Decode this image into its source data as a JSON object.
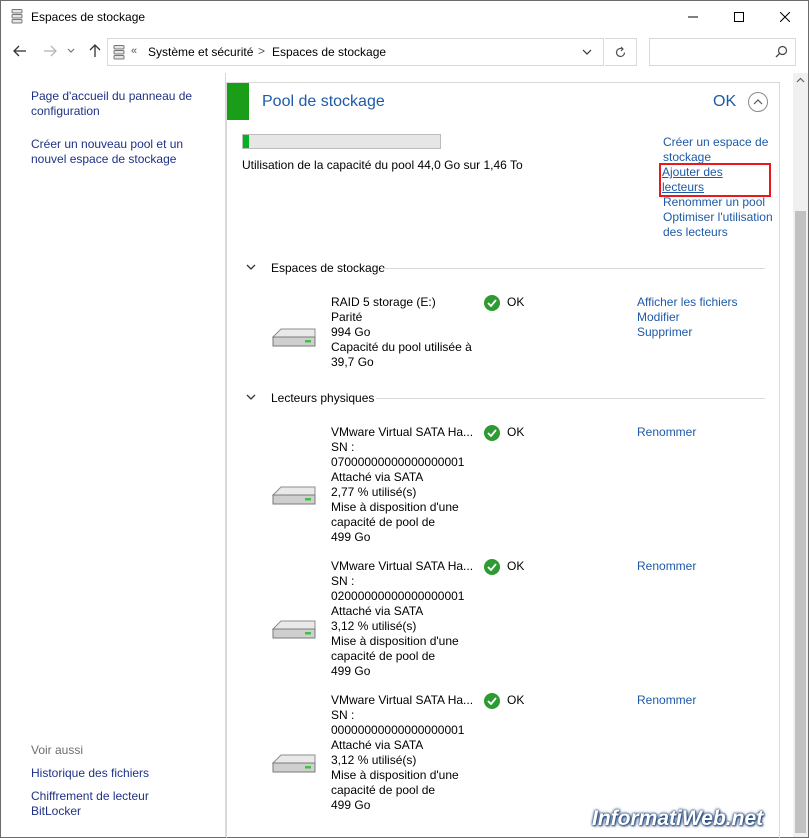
{
  "window": {
    "title": "Espaces de stockage"
  },
  "address_bar": {
    "overflow": "«",
    "crumb_1": "Système et sécurité",
    "separator": ">",
    "crumb_2": "Espaces de stockage",
    "search_placeholder": ""
  },
  "left_nav": {
    "links": [
      "Page d'accueil du panneau de configuration",
      "Créer un nouveau pool et un nouvel espace de stockage"
    ],
    "see_also_heading": "Voir aussi",
    "see_also_links": [
      "Historique des fichiers",
      "Chiffrement de lecteur BitLocker"
    ]
  },
  "pool": {
    "title": "Pool de stockage",
    "status": "OK",
    "usage_percent": 3,
    "usage_text": "Utilisation de la capacité du pool 44,0 Go sur 1,46 To",
    "actions": [
      "Créer un espace de stockage",
      "Ajouter des lecteurs",
      "Renommer un pool",
      "Optimiser l'utilisation des lecteurs"
    ]
  },
  "spaces_section": {
    "heading": "Espaces de stockage",
    "items": [
      {
        "lines": [
          "RAID 5 storage (E:)",
          "Parité",
          "994 Go",
          "Capacité du pool utilisée à 39,7 Go"
        ],
        "status": "OK",
        "actions": [
          "Afficher les fichiers",
          "Modifier",
          "Supprimer"
        ]
      }
    ]
  },
  "physical_section": {
    "heading": "Lecteurs physiques",
    "items": [
      {
        "lines": [
          "VMware Virtual SATA Ha...",
          "SN :",
          "07000000000000000001",
          "Attaché via SATA",
          "2,77 % utilisé(s)",
          "Mise à disposition d'une capacité de pool de",
          "499 Go"
        ],
        "status": "OK",
        "action": "Renommer"
      },
      {
        "lines": [
          "VMware Virtual SATA Ha...",
          "SN :",
          "02000000000000000001",
          "Attaché via SATA",
          "3,12 % utilisé(s)",
          "Mise à disposition d'une capacité de pool de",
          "499 Go"
        ],
        "status": "OK",
        "action": "Renommer"
      },
      {
        "lines": [
          "VMware Virtual SATA Ha...",
          "SN :",
          "00000000000000000001",
          "Attaché via SATA",
          "3,12 % utilisé(s)",
          "Mise à disposition d'une capacité de pool de",
          "499 Go"
        ],
        "status": "OK",
        "action": "Renommer"
      }
    ]
  },
  "watermark": "InformatiWeb.net",
  "colors": {
    "link": "#1e5aa8",
    "accent_green": "#1a9e1a",
    "progress_fill": "#06b025",
    "highlight_box": "#e8181c"
  },
  "icons": {
    "app": "storage-spaces-icon",
    "disk": "hard-drive-icon",
    "status": "ok-check-icon"
  }
}
